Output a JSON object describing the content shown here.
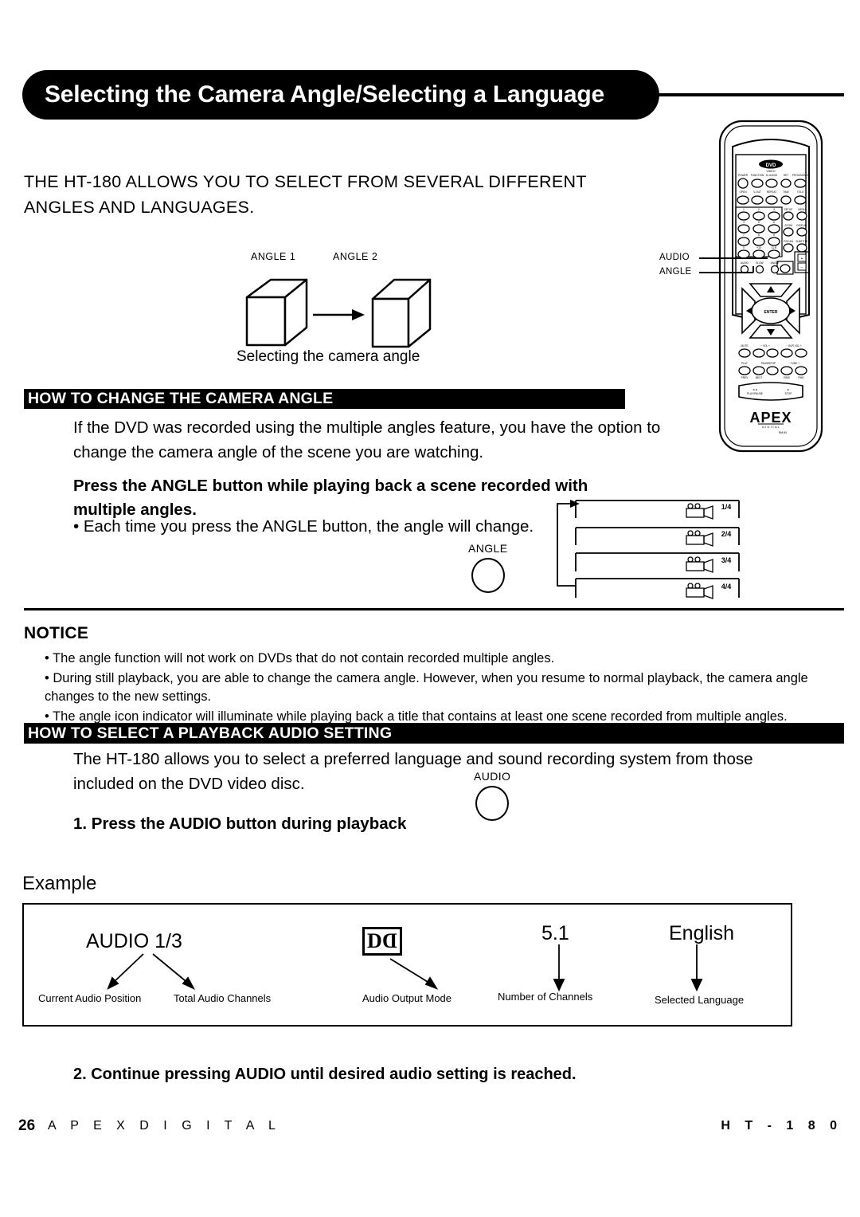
{
  "page": {
    "title": "Selecting the Camera Angle/Selecting a Language",
    "intro_line1": "THE HT-180 ALLOWS YOU TO SELECT FROM SEVERAL DIFFERENT",
    "intro_line2": "ANGLES AND LANGUAGES."
  },
  "angle_diagram": {
    "label_1": "ANGLE 1",
    "label_2": "ANGLE 2",
    "caption": "Selecting the camera angle"
  },
  "remote": {
    "callout_audio": "AUDIO",
    "callout_angle": "ANGLE",
    "logo_top": "DVD",
    "logo_top_sub": "VIDEO",
    "brand": "APEX",
    "brand_sub": "DIGITAL",
    "enter_label": "ENTER"
  },
  "section_camera": {
    "header": "HOW TO CHANGE THE CAMERA ANGLE",
    "body": "If the DVD was recorded using the multiple angles feature, you have the option to change the camera angle of the scene you are watching.",
    "instruction": "Press the ANGLE button while playing back a scene recorded with multiple angles.",
    "bullet": "• Each time you press the ANGLE button, the angle will change.",
    "button_label": "ANGLE",
    "cycle_panels": [
      "1/4",
      "2/4",
      "3/4",
      "4/4"
    ]
  },
  "notice": {
    "title": "NOTICE",
    "items": [
      "• The angle function will not work on DVDs that do not contain recorded multiple angles.",
      "• During still playback, you are able to change the camera angle.  However, when you resume to normal playback, the camera angle changes to the new settings.",
      "• The angle icon indicator will illuminate while playing back a title that contains at least one scene recorded from multiple angles."
    ]
  },
  "section_audio": {
    "header": "HOW TO SELECT A PLAYBACK AUDIO SETTING",
    "body": "The HT-180 allows you to select a preferred language and sound recording system from those included on the DVD video disc.",
    "button_label": "AUDIO",
    "step1": "1. Press the AUDIO button during playback",
    "step2": "2. Continue pressing AUDIO until desired audio setting is reached."
  },
  "example": {
    "label": "Example",
    "audio_value": "AUDIO  1/3",
    "dolby_left": "D",
    "dolby_right": "D",
    "channels_value": "5.1",
    "language_value": "English",
    "caption_current_position": "Current Audio Position",
    "caption_total_channels": "Total Audio Channels",
    "caption_output_mode": "Audio Output Mode",
    "caption_number_channels": "Number of Channels",
    "caption_selected_language": "Selected Language"
  },
  "footer": {
    "page_number": "26",
    "brand": "A P E X   D I G I T A L",
    "model": "H T - 1 8 0"
  },
  "colors": {
    "ink": "#000000",
    "paper": "#ffffff"
  }
}
